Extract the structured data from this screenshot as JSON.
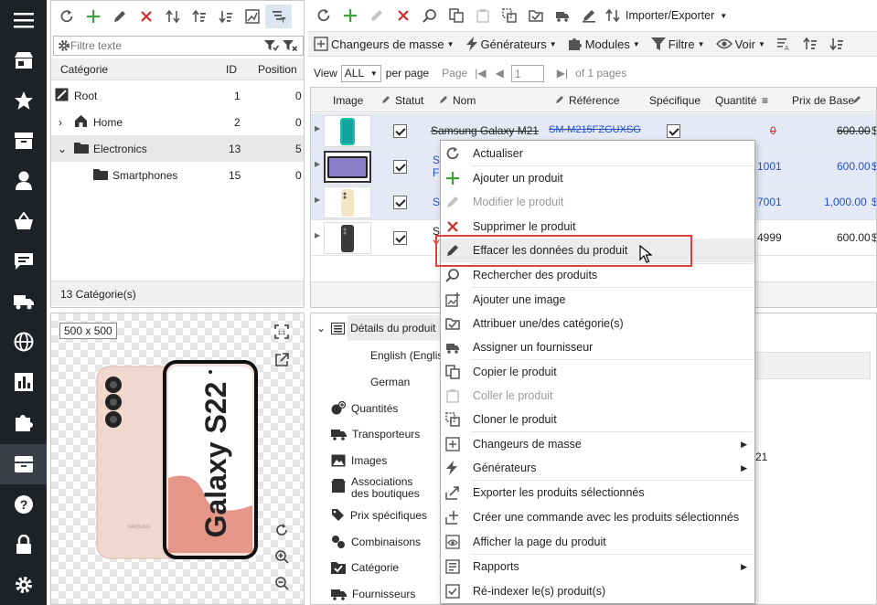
{
  "colors": {
    "nav_bg": "#1e2226",
    "accent_blue": "#2350c8",
    "delete_red": "#d32a2a",
    "add_green": "#3aa33a",
    "highlight_red": "#e0403a",
    "selected_row": "#e4e9f5"
  },
  "nav": {
    "items": [
      "menu-icon",
      "store-icon",
      "star-icon",
      "box-icon",
      "user-icon",
      "basket-icon",
      "chat-icon",
      "truck-icon",
      "globe-icon",
      "chart-icon",
      "puzzle-icon",
      "archive-icon",
      "help-icon",
      "lock-icon",
      "gear-icon"
    ],
    "active_index": 11
  },
  "categories": {
    "filter_placeholder": "Filtre texte",
    "headers": {
      "category": "Catégorie",
      "id": "ID",
      "position": "Position"
    },
    "rows": [
      {
        "name": "Root",
        "id": "1",
        "position": "0"
      },
      {
        "name": "Home",
        "id": "2",
        "position": "0"
      },
      {
        "name": "Electronics",
        "id": "13",
        "position": "5"
      },
      {
        "name": "Smartphones",
        "id": "15",
        "position": "0"
      }
    ],
    "footer": "13 Catégorie(s)"
  },
  "preview": {
    "dims": "500 x 500",
    "phone_text": "Galaxy S22",
    "brand": "SAMSUNG"
  },
  "toolbar": {
    "import_export": "Importer/Exporter"
  },
  "menubar": {
    "mass_changers": "Changeurs de masse",
    "generators": "Générateurs",
    "modules": "Modules",
    "filter": "Filtre",
    "view": "Voir"
  },
  "pager": {
    "view_label": "View",
    "view_value": "ALL",
    "per_page": "per page",
    "page_label": "Page",
    "page_value": "1",
    "of_pages": "of 1 pages"
  },
  "grid": {
    "headers": {
      "image": "Image",
      "status": "Statut",
      "name": "Nom",
      "reference": "Référence",
      "specific": "Spécifique",
      "quantity": "Quantité",
      "base_price": "Prix de Base"
    },
    "rows": [
      {
        "name": "Samsung Galaxy M21",
        "reference": "SM-M215FZGUXSG",
        "quantity": "0",
        "price": "600.00",
        "suffix": "$"
      },
      {
        "name": "S",
        "name2": "F",
        "reference": "",
        "quantity": "1001",
        "price": "600.00",
        "suffix": "$"
      },
      {
        "name": "S",
        "reference": "",
        "quantity": "7001",
        "price": "1,000.00",
        "suffix": "$"
      },
      {
        "name": "S",
        "name2": "Y",
        "reference": "",
        "quantity": "4999",
        "price": "600.00",
        "suffix": "$"
      }
    ]
  },
  "details": {
    "items": [
      "Détails du produit",
      "English (Englis",
      "German",
      "Quantités",
      "Transporteurs",
      "Images",
      "Associations des boutiques",
      "Prix spécifiques",
      "Combinaisons",
      "Catégorie",
      "Fournisseurs"
    ],
    "side_value": "21"
  },
  "context_menu": {
    "items": [
      {
        "label": "Actualiser",
        "icon": "refresh-icon"
      },
      {
        "label": "Ajouter un produit",
        "icon": "plus-icon"
      },
      {
        "label": "Modifier le produit",
        "icon": "pencil-icon",
        "disabled": true
      },
      {
        "label": "Supprimer le produit",
        "icon": "delete-icon"
      },
      {
        "label": "Effacer les données du produit",
        "icon": "eraser-icon",
        "hover": true
      },
      {
        "label": "Rechercher des produits",
        "icon": "search-icon"
      },
      {
        "label": "Ajouter une image",
        "icon": "add-image-icon"
      },
      {
        "label": "Attribuer une/des catégorie(s)",
        "icon": "category-icon"
      },
      {
        "label": "Assigner un fournisseur",
        "icon": "supplier-icon"
      },
      {
        "label": "Copier le produit",
        "icon": "copy-icon"
      },
      {
        "label": "Coller le produit",
        "icon": "paste-icon",
        "disabled": true
      },
      {
        "label": "Cloner le produit",
        "icon": "clone-icon"
      },
      {
        "label": "Changeurs de masse",
        "icon": "mass-change-icon",
        "submenu": true
      },
      {
        "label": "Générateurs",
        "icon": "lightning-icon",
        "submenu": true
      },
      {
        "label": "Exporter les produits sélectionnés",
        "icon": "export-icon"
      },
      {
        "label": "Créer une commande avec les produits sélectionnés",
        "icon": "order-icon"
      },
      {
        "label": "Afficher la page du produit",
        "icon": "eye-icon"
      },
      {
        "label": "Rapports",
        "icon": "report-icon",
        "submenu": true
      },
      {
        "label": "Ré-indexer le(s) produit(s)",
        "icon": "reindex-icon"
      }
    ]
  }
}
